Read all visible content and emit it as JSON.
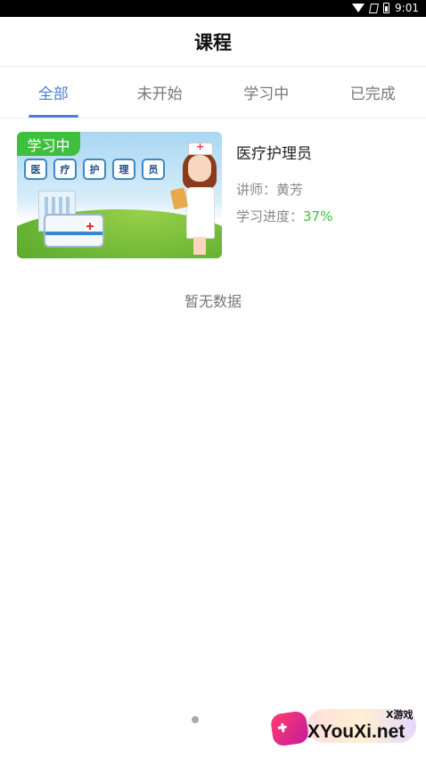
{
  "status_bar": {
    "time": "9:01"
  },
  "header": {
    "title": "课程"
  },
  "tabs": [
    {
      "label": "全部",
      "active": true
    },
    {
      "label": "未开始",
      "active": false
    },
    {
      "label": "学习中",
      "active": false
    },
    {
      "label": "已完成",
      "active": false
    }
  ],
  "course": {
    "badge": "学习中",
    "thumbnail_text": [
      "医",
      "疗",
      "护",
      "理",
      "员"
    ],
    "title": "医疗护理员",
    "teacher_label": "讲师：",
    "teacher": "黄芳",
    "progress_label": "学习进度：",
    "progress": "37%"
  },
  "empty_text": "暂无数据",
  "watermark": {
    "small": "X游戏",
    "text": "XYouXi.net"
  },
  "colors": {
    "accent": "#4a7fd3",
    "badge": "#3ec03e",
    "progress": "#3ec03e"
  }
}
